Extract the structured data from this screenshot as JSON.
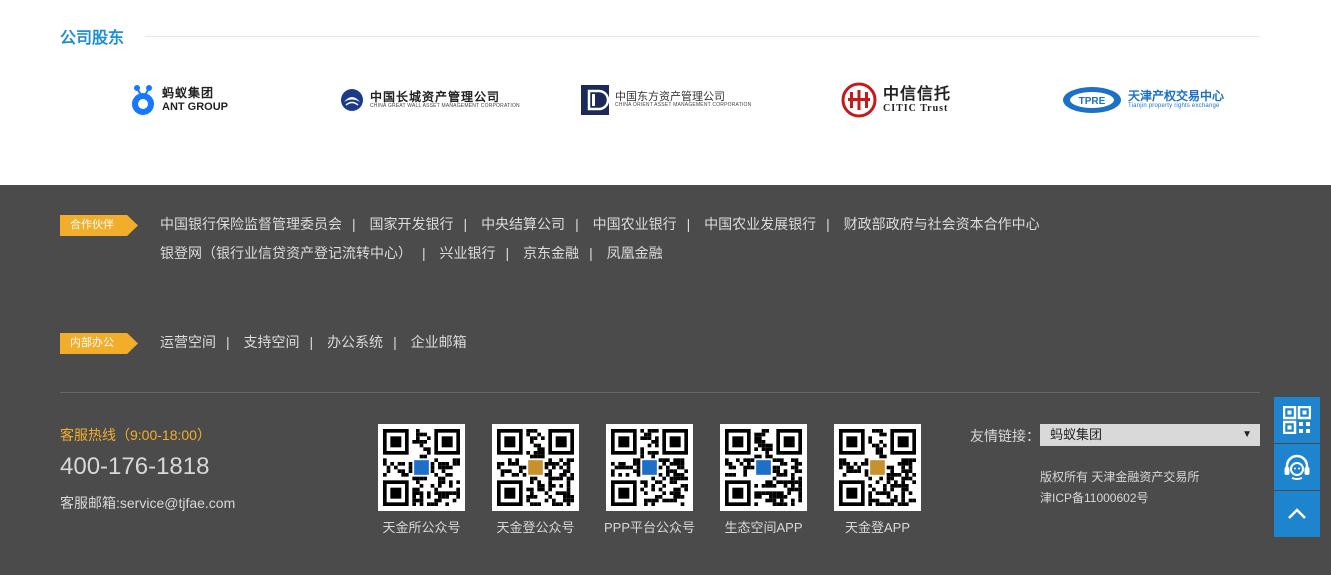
{
  "shareholders": {
    "title": "公司股东",
    "logos": [
      {
        "name": "蚂蚁集团",
        "sub": "ANT GROUP"
      },
      {
        "name": "中国长城资产管理公司",
        "sub": "CHINA GREAT WALL ASSET MANAGEMENT CORPORATION"
      },
      {
        "name": "中国东方资产管理公司",
        "sub": "CHINA ORIENT ASSET MANAGEMENT CORPORATION"
      },
      {
        "name": "中信信托",
        "sub": "CITIC Trust"
      },
      {
        "name": "天津产权交易中心",
        "sub": "Tianjin property rights exchange"
      }
    ]
  },
  "partners": {
    "tag": "合作伙伴",
    "row1": [
      "中国银行保险监督管理委员会",
      "国家开发银行",
      "中央结算公司",
      "中国农业银行",
      "中国农业发展银行",
      "财政部政府与社会资本合作中心"
    ],
    "row2": [
      "银登网（银行业信贷资产登记流转中心）",
      "兴业银行",
      "京东金融",
      "凤凰金融"
    ]
  },
  "internal": {
    "tag": "内部办公",
    "links": [
      "运营空间",
      "支持空间",
      "办公系统",
      "企业邮箱"
    ]
  },
  "service": {
    "hotline_label": "客服热线（9:00-18:00）",
    "phone": "400-176-1818",
    "email": "客服邮箱:service@tjfae.com"
  },
  "qrcodes": [
    "天金所公众号",
    "天金登公众号",
    "PPP平台公众号",
    "生态空间APP",
    "天金登APP"
  ],
  "friend_links": {
    "label": "友情链接：",
    "selected": "蚂蚁集团"
  },
  "copyright": {
    "line1": "版权所有 天津金融资产交易所",
    "line2": "津ICP备11000602号"
  },
  "colors": {
    "accent_blue": "#1e8fd6",
    "tag_orange": "#f2ae2b",
    "footer_bg": "#4b4b4b",
    "side_btn": "#1d84cd"
  }
}
